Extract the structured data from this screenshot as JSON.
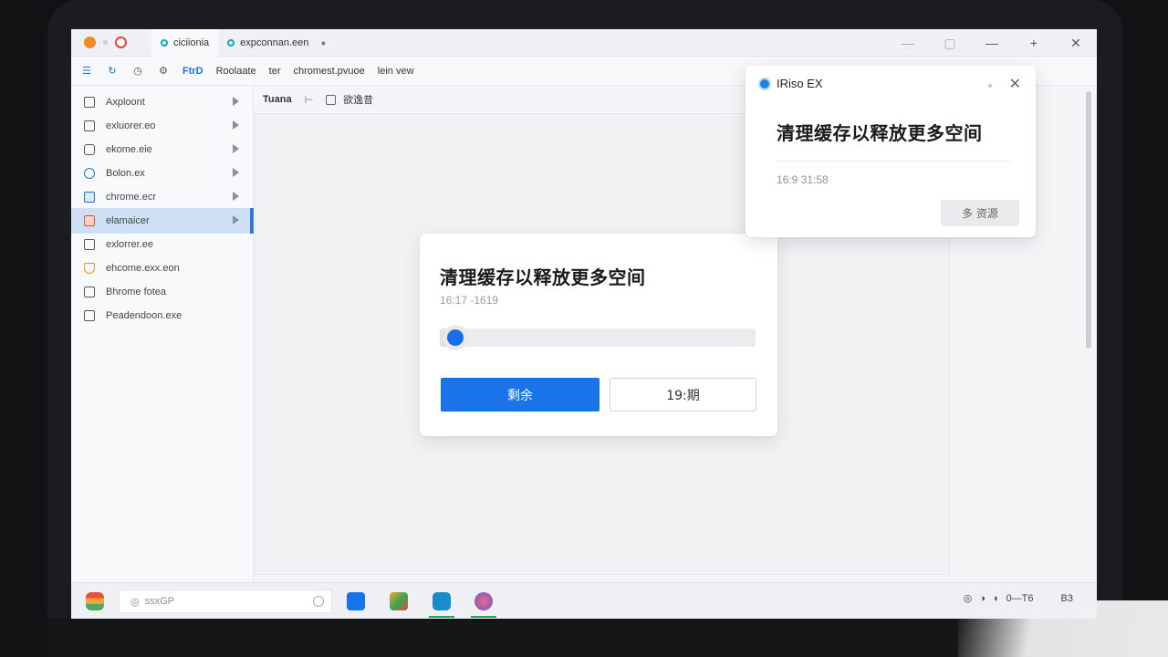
{
  "titlebar": {
    "tabs": [
      {
        "label": "ciciionia"
      },
      {
        "label": "expconnan.een"
      }
    ],
    "controls": {
      "minimize": "—",
      "restore": "▢",
      "maximize": "—",
      "new": "+",
      "close": "✕"
    }
  },
  "toolbar": {
    "items": [
      {
        "label": "FtrD"
      },
      {
        "label": "Roolaate"
      },
      {
        "label": "ter"
      },
      {
        "label": "chromest.pvuoe"
      },
      {
        "label": "lein vew"
      }
    ]
  },
  "sidebar": {
    "items": [
      {
        "label": "Axploont"
      },
      {
        "label": "exluorer.eo"
      },
      {
        "label": "ekome.eie"
      },
      {
        "label": "Bolon.ex"
      },
      {
        "label": "chrome.ecr"
      },
      {
        "label": "elamaicer"
      },
      {
        "label": "exlorrer.ee"
      },
      {
        "label": "ehcome.exx.eon"
      },
      {
        "label": "Bhrome fotea"
      },
      {
        "label": "Peadendoon.exe"
      }
    ]
  },
  "main_header": {
    "title": "Tuana",
    "item2": "欲逸昔"
  },
  "dialog": {
    "title": "清理缓存以释放更多空间",
    "subtitle": "16:17 -1619",
    "progress": 0.05,
    "primary_label": "剩余",
    "secondary_label": "19:期"
  },
  "notification": {
    "app_name": "IRiso EX",
    "title": "清理缓存以释放更多空间",
    "time": "16:9 31:58",
    "action_label": "多 资源"
  },
  "taskbar": {
    "search_placeholder": "ssxGP",
    "tray_text": "0—T6",
    "tray_end": "B3"
  },
  "colors": {
    "accent": "#1a73e8",
    "selection": "#cfe0f5",
    "selection_border": "#2f78d6"
  }
}
